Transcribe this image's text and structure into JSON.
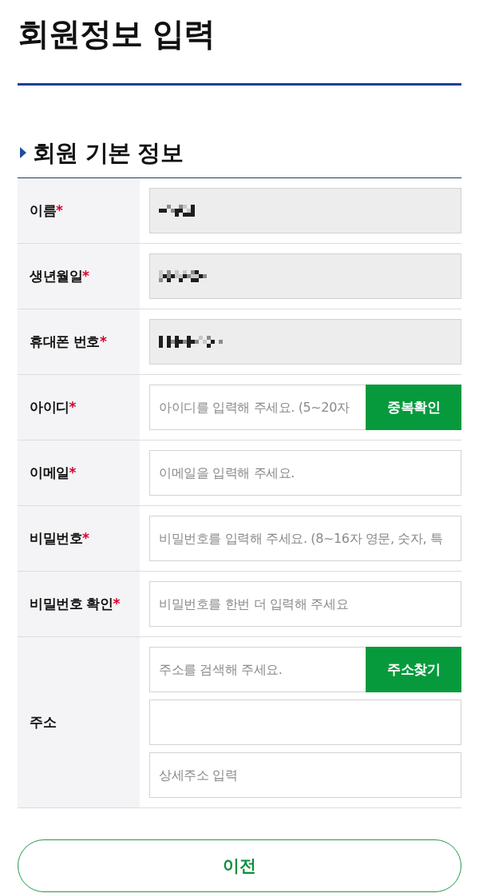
{
  "page_title": "회원정보 입력",
  "section": {
    "title": "회원 기본 정보"
  },
  "rows": [
    {
      "label": "이름",
      "mark": "*",
      "fields": [
        {
          "disabled": true,
          "redacted": true
        }
      ]
    },
    {
      "label": "생년월일",
      "mark": "*",
      "fields": [
        {
          "disabled": true,
          "redacted": true
        }
      ]
    },
    {
      "label": "휴대폰 번호",
      "mark": "*",
      "fields": [
        {
          "disabled": true,
          "redacted": true
        }
      ]
    },
    {
      "label": "아이디",
      "mark": "*",
      "fields": [
        {
          "placeholder": "아이디를 입력해 주세요. (5~20자",
          "disabled": false,
          "redacted": false,
          "button": "중복확인"
        }
      ]
    },
    {
      "label": "이메일",
      "mark": "*",
      "fields": [
        {
          "placeholder": "이메일을 입력해 주세요.",
          "disabled": false,
          "redacted": false
        }
      ]
    },
    {
      "label": "비밀번호",
      "mark": "*",
      "fields": [
        {
          "placeholder": "비밀번호를 입력해 주세요. (8~16자 영문, 숫자, 특",
          "disabled": false,
          "redacted": false
        }
      ]
    },
    {
      "label": "비밀번호 확인",
      "mark": "*",
      "fields": [
        {
          "placeholder": "비밀번호를 한번 더 입력해 주세요",
          "disabled": false,
          "redacted": false
        }
      ]
    },
    {
      "label": "주소",
      "fields": [
        {
          "placeholder": "주소를 검색해 주세요.",
          "disabled": false,
          "redacted": false,
          "button": "주소찾기"
        },
        {
          "disabled": false,
          "redacted": false
        },
        {
          "placeholder": "상세주소 입력",
          "disabled": false,
          "redacted": false
        }
      ]
    }
  ],
  "buttons": [
    {
      "label": "이전"
    }
  ]
}
